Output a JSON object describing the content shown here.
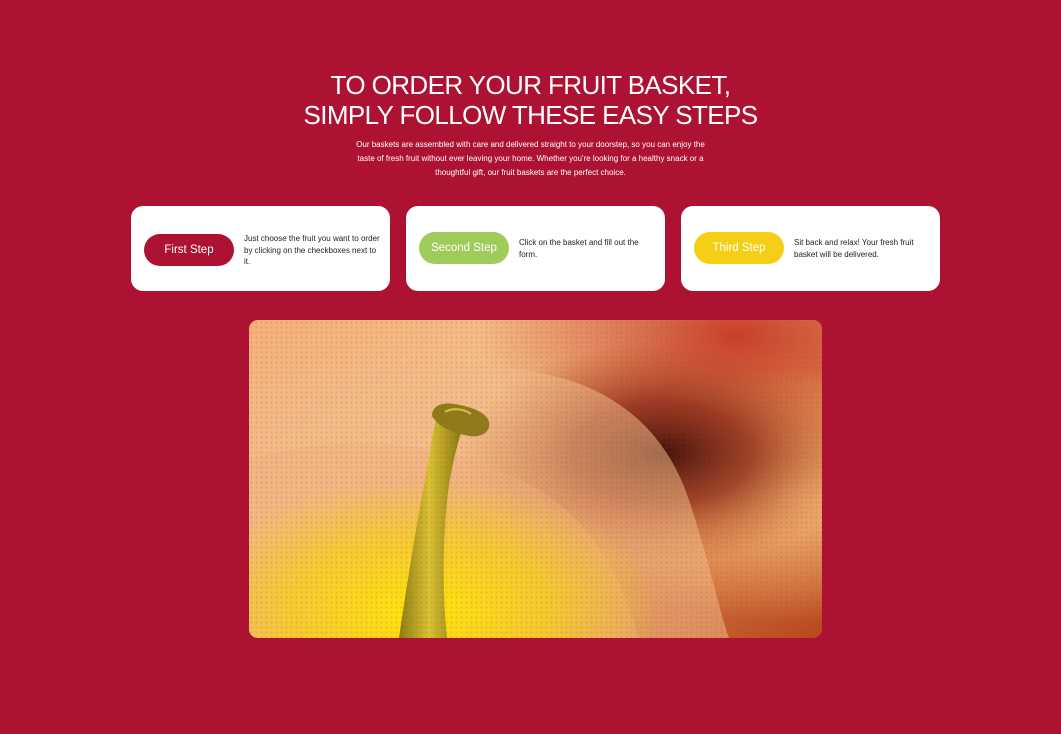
{
  "page": {
    "background": "#ae1233"
  },
  "hero": {
    "title_line1": "TO ORDER YOUR FRUIT BASKET,",
    "title_line2": "SIMPLY FOLLOW THESE EASY STEPS",
    "intro": "Our baskets are assembled with care and delivered straight to your doorstep, so you can enjoy the taste of fresh fruit without ever leaving your home. Whether you're looking for a healthy snack or a thoughtful gift, our fruit baskets are the perfect choice."
  },
  "steps": [
    {
      "button_label": "First Step",
      "button_color": "#ae1233",
      "text": "Just choose the fruit you want to order by clicking on the checkboxes next to it."
    },
    {
      "button_label": "Second Step",
      "button_color": "#9fcb5b",
      "text": "Click on the basket and fill out the form."
    },
    {
      "button_label": "Third Step",
      "button_color": "#f5cf16",
      "text": "Sit back and relax! Your fresh fruit basket will be delivered."
    }
  ],
  "image": {
    "subject": "close-up of an apple stem"
  }
}
